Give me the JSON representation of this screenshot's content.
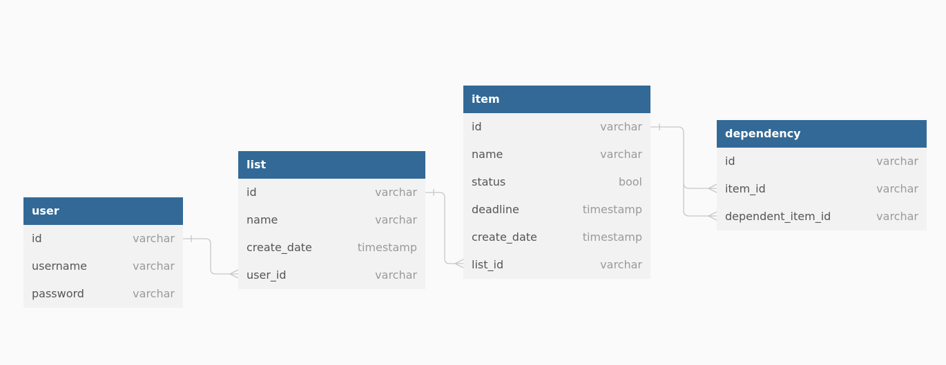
{
  "colors": {
    "background": "#fafafa",
    "table_header": "#336996",
    "table_body": "#f2f2f2",
    "relation_line": "#c6c6c6"
  },
  "tables": {
    "user": {
      "name": "user",
      "fields": [
        {
          "name": "id",
          "type": "varchar"
        },
        {
          "name": "username",
          "type": "varchar"
        },
        {
          "name": "password",
          "type": "varchar"
        }
      ]
    },
    "list": {
      "name": "list",
      "fields": [
        {
          "name": "id",
          "type": "varchar"
        },
        {
          "name": "name",
          "type": "varchar"
        },
        {
          "name": "create_date",
          "type": "timestamp"
        },
        {
          "name": "user_id",
          "type": "varchar"
        }
      ]
    },
    "item": {
      "name": "item",
      "fields": [
        {
          "name": "id",
          "type": "varchar"
        },
        {
          "name": "name",
          "type": "varchar"
        },
        {
          "name": "status",
          "type": "bool"
        },
        {
          "name": "deadline",
          "type": "timestamp"
        },
        {
          "name": "create_date",
          "type": "timestamp"
        },
        {
          "name": "list_id",
          "type": "varchar"
        }
      ]
    },
    "dependency": {
      "name": "dependency",
      "fields": [
        {
          "name": "id",
          "type": "varchar"
        },
        {
          "name": "item_id",
          "type": "varchar"
        },
        {
          "name": "dependent_item_id",
          "type": "varchar"
        }
      ]
    }
  },
  "relations": [
    {
      "from": "user.id",
      "to": "list.user_id",
      "cardinality": "one-to-many"
    },
    {
      "from": "list.id",
      "to": "item.list_id",
      "cardinality": "one-to-many"
    },
    {
      "from": "item.id",
      "to": "dependency.item_id",
      "cardinality": "one-to-many"
    },
    {
      "from": "item.id",
      "to": "dependency.dependent_item_id",
      "cardinality": "one-to-many"
    }
  ]
}
